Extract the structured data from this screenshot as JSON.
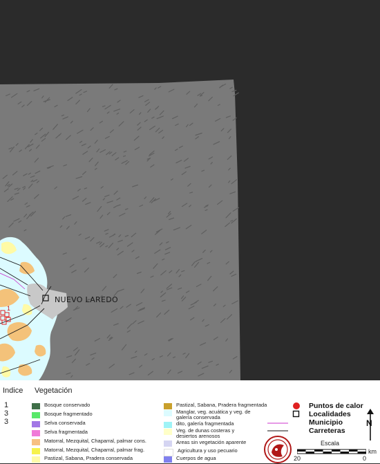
{
  "map": {
    "city_label": "NUEVO LAREDO",
    "hotspot_index_label": "1",
    "colors": {
      "background": "#2b2b2b",
      "relief": "#7a7a7a",
      "urban": "#bdbdbd",
      "mezquital": "#f4c27a",
      "pastizal_conservado": "#fffaa6",
      "agua": "#cceeff"
    }
  },
  "legend": {
    "index_header": "Indice",
    "vegetation_header": "Vegetación",
    "index_values": [
      "1",
      "3",
      "3"
    ],
    "vegetation_items": [
      {
        "label": "Bosque conservado",
        "color": "#3f6f48"
      },
      {
        "label": "Bosque fragmentado",
        "color": "#59e86a"
      },
      {
        "label": "Selva conservada",
        "color": "#a277e6"
      },
      {
        "label": "Selva fragmentada",
        "color": "#f07ad8"
      },
      {
        "label": "Matorral, Mezquital, Chaparral, palmar cons.",
        "color": "#f7c083"
      },
      {
        "label": "Matorral, Mezquital, Chaparral, palmar frag.",
        "color": "#f6f24d"
      },
      {
        "label": "Pastizal, Sabana, Pradera conservada",
        "color": "#fffba9"
      },
      {
        "label": "Pastizal, Sabana, Pradera fragmentada",
        "color": "#c9a02c"
      },
      {
        "label": "Manglar, veg. acuática y veg. de galería conservada",
        "color": "#dcfbff"
      },
      {
        "label": "dito, galería fragmentada",
        "color": "#9ff3f6"
      },
      {
        "label": "Veg. de dunas costeras y desiertos arenosos",
        "color": "#ffffc8"
      },
      {
        "label": "Areas sin vegetación aparente",
        "color": "#d5d5f2"
      },
      {
        "label": "Agricultura y uso pecuario",
        "color": "#ffffff"
      },
      {
        "label": "Cuerpos de agua",
        "color": "#8080ee"
      }
    ],
    "symbols": [
      {
        "label": "Puntos de calor",
        "icon": "red-dot"
      },
      {
        "label": "Localidades",
        "icon": "square"
      },
      {
        "label": "Municipio",
        "icon": "magenta-line"
      },
      {
        "label": "Carreteras",
        "icon": "black-line"
      }
    ],
    "scale": {
      "title": "Escala",
      "left": "20",
      "right": "0",
      "unit": "km"
    },
    "north_label": "N"
  }
}
